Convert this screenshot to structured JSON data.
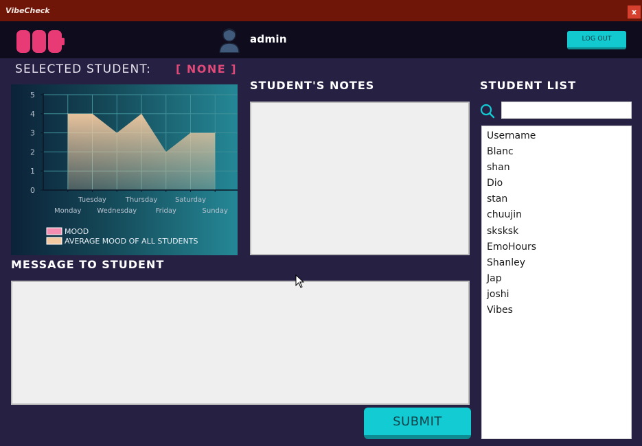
{
  "window": {
    "title": "VibeCheck",
    "close_label": "x"
  },
  "header": {
    "username": "admin",
    "logout_label": "LOG OUT"
  },
  "selected_student": {
    "label": "SELECTED STUDENT:",
    "value": "[ NONE ]"
  },
  "chart_data": {
    "type": "area",
    "categories": [
      "Monday",
      "Tuesday",
      "Wednesday",
      "Thursday",
      "Friday",
      "Saturday",
      "Sunday"
    ],
    "series": [
      {
        "name": "MOOD",
        "values": []
      },
      {
        "name": "AVERAGE MOOD OF ALL STUDENTS",
        "values": [
          4,
          4,
          3,
          4,
          2,
          3,
          3
        ]
      }
    ],
    "ylim": [
      0,
      5
    ],
    "yticks": [
      "0",
      "1",
      "2",
      "3",
      "4",
      "5"
    ],
    "grid": true,
    "legend": "bottom",
    "colors": {
      "mood": "#f48fb1",
      "average": "#f2c9a0"
    }
  },
  "notes": {
    "heading": "STUDENT'S NOTES"
  },
  "message": {
    "heading": "MESSAGE TO STUDENT",
    "submit_label": "SUBMIT"
  },
  "student_list": {
    "heading": "STUDENT LIST",
    "search_placeholder": "",
    "items": [
      "Username",
      "Blanc",
      "shan",
      "Dio",
      "stan",
      "chuujin",
      "sksksk",
      "EmoHours",
      "Shanley",
      "Jap",
      "joshi",
      "Vibes"
    ]
  },
  "colors": {
    "accent": "#13ccd3",
    "brand": "#e83a74",
    "titlebar": "#6f1609",
    "background": "#262143"
  }
}
